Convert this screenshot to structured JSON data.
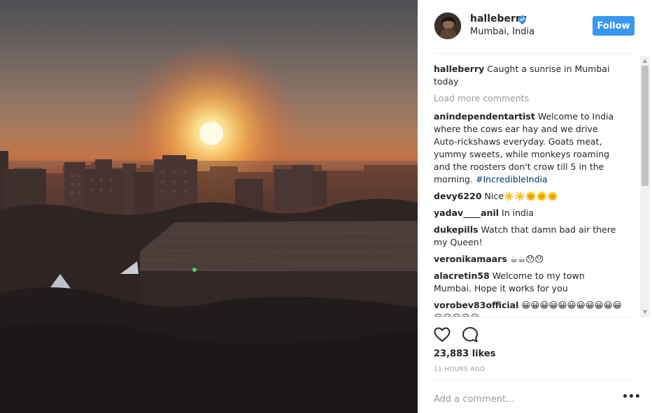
{
  "post": {
    "username": "halleberry",
    "location": "Mumbai, India",
    "follow_label": "Follow",
    "likes": "23,883 likes",
    "timestamp": "11 HOURS AGO",
    "comment_placeholder": "Add a comment...",
    "load_more": "Load more comments"
  },
  "caption": {
    "user": "halleberry",
    "text": "Caught a sunrise in Mumbai today"
  },
  "comments": [
    {
      "user": "anindependentartist",
      "text": "Welcome to India where the cows ear hay and we drive Auto-rickshaws everyday. Goats meat, yummy sweets, while monkeys roaming and the roosters don't crow till 5 in the morning.",
      "hashtag": "#IncredibleIndia"
    },
    {
      "user": "devy6220",
      "text": "Nice☀️☀️🌞🌞🌞"
    },
    {
      "user": "yadav____anil",
      "text": "In india"
    },
    {
      "user": "dukepills",
      "text": "Watch that damn bad air there my Queen!"
    },
    {
      "user": "veronikamaars",
      "text": "☕☕😯😯"
    },
    {
      "user": "alacretin58",
      "text": "Welcome to my town Mumbai. Hope it works for you"
    },
    {
      "user": "vorobev83official",
      "text": "😀😀😀😀😀😀😀😀😀😀😀😀😀😀😀😀"
    }
  ],
  "icons": {
    "like": "heart-icon",
    "comment": "speech-bubble-icon",
    "verified": "verified-badge-icon",
    "more": "ellipsis-icon"
  },
  "colors": {
    "accent": "#3897f0",
    "text": "#262626",
    "muted": "#999999",
    "hashtag": "#003569"
  }
}
